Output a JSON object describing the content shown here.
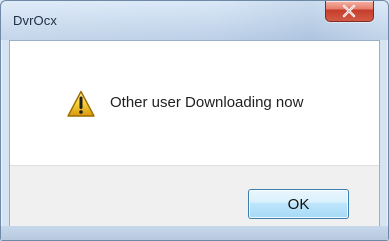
{
  "window": {
    "title": "DvrOcx"
  },
  "dialog": {
    "message": "Other user Downloading now",
    "ok_label": "OK"
  },
  "icons": {
    "close": "close-icon",
    "warning": "warning-icon"
  },
  "colors": {
    "close_button": "#d35a44",
    "warning_fill": "#f0c419",
    "ok_button_border": "#3c7fb1"
  }
}
